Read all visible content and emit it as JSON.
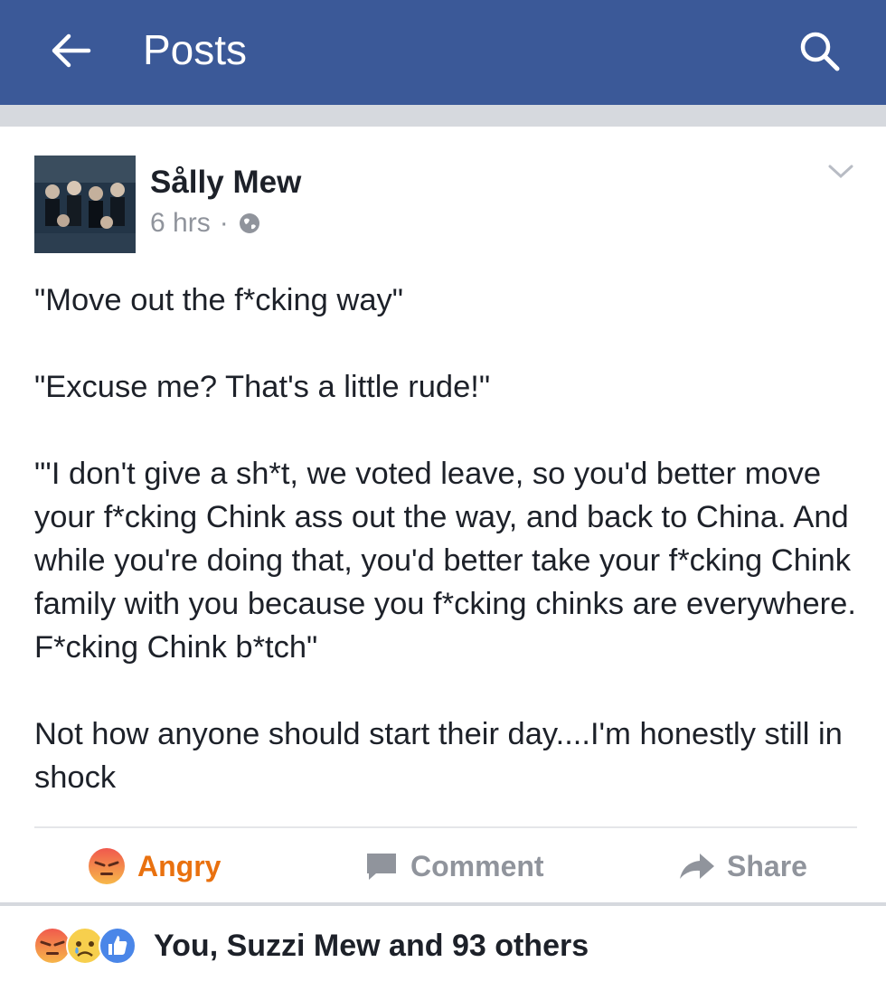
{
  "header": {
    "title": "Posts",
    "back_icon": "arrow-left-icon",
    "search_icon": "search-icon",
    "bg_color": "#3b5998"
  },
  "post": {
    "author": "Sålly Mew",
    "time": "6 hrs",
    "separator": "·",
    "privacy_icon": "globe-icon",
    "menu_icon": "chevron-down-icon",
    "paragraphs": [
      "\"Move out the f*cking way\"",
      "\"Excuse me? That's a little rude!\"",
      "\"'I don't give a sh*t, we voted leave, so you'd better move your f*cking Chink ass out the way, and back to China. And while you're doing that, you'd better take your f*cking Chink family with you because you f*cking chinks are everywhere. F*cking Chink b*tch\"",
      "Not how anyone should start their day....I'm honestly still in shock"
    ]
  },
  "actions": {
    "angry_label": "Angry",
    "comment_label": "Comment",
    "share_label": "Share",
    "angry_color": "#e9710f"
  },
  "reactions": {
    "icons": [
      "angry-icon",
      "sad-icon",
      "like-icon"
    ],
    "summary": "You, Suzzi Mew and 93 others"
  }
}
